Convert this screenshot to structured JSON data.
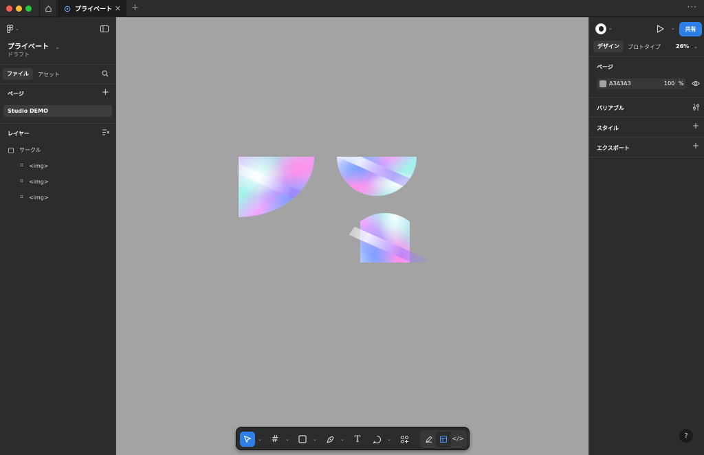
{
  "window": {
    "tab_title": "プライベート"
  },
  "left_panel": {
    "file_name": "プライベート",
    "file_status": "ドラフト",
    "tabs": [
      "ファイル",
      "アセット"
    ],
    "pages_title": "ページ",
    "page_item": "Studio DEMO",
    "layers_title": "レイヤー",
    "layers": [
      {
        "name": "サークル",
        "indent": false
      },
      {
        "name": "<img>",
        "indent": true
      },
      {
        "name": "<img>",
        "indent": true
      },
      {
        "name": "<img>",
        "indent": true
      }
    ]
  },
  "right_panel": {
    "share_label": "共有",
    "tabs": [
      "デザイン",
      "プロトタイプ"
    ],
    "zoom": "26%",
    "page_section_title": "ページ",
    "background_hex": "A3A3A3",
    "opacity": "100",
    "opacity_unit": "%",
    "variables_title": "バリアブル",
    "styles_title": "スタイル",
    "export_title": "エクスポート",
    "help_label": "?"
  },
  "colors": {
    "canvas_bg": "#a3a3a3",
    "accent": "#2f7fe8"
  }
}
